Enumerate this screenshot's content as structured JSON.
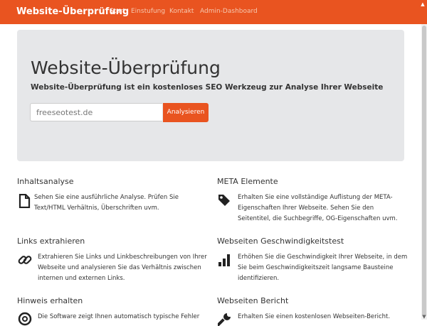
{
  "navbar": {
    "brand": "Website-Überprüfung",
    "items": [
      {
        "label": "Start",
        "active": true
      },
      {
        "label": "Einstufung",
        "active": false
      },
      {
        "label": "Kontakt",
        "active": false
      },
      {
        "label": "Admin-Dashboard",
        "active": false
      }
    ],
    "accent": "#e95420"
  },
  "hero": {
    "title": "Website-Überprüfung",
    "subtitle": "Website-Überprüfung ist ein kostenloses SEO Werkzeug zur Analyse Ihrer Webseite",
    "input_value": "freeseotest.de",
    "button_label": "Analysieren"
  },
  "features": [
    {
      "title": "Inhaltsanalyse",
      "icon": "file-icon",
      "text_lines": [
        "Sehen Sie eine ausführliche Analyse. Prüfen Sie",
        "Text/HTML Verhältnis, Überschriften uvm."
      ]
    },
    {
      "title": "META Elemente",
      "icon": "tag-icon",
      "text_lines": [
        "Erhalten Sie eine vollständige Auflistung der META-",
        "Eigenschaften Ihrer Webseite. Sehen Sie den",
        "Seitentitel, die Suchbegriffe, OG-Eigenschaften uvm."
      ]
    },
    {
      "title": "Links extrahieren",
      "icon": "link-icon",
      "text_lines": [
        "Extrahieren Sie Links und Linkbeschreibungen von Ihrer",
        "Webseite und analysieren Sie das Verhältnis zwischen",
        "internen und externen Links."
      ]
    },
    {
      "title": "Webseiten Geschwindigkeitstest",
      "icon": "bar-chart-icon",
      "text_lines": [
        "Erhöhen Sie die Geschwindigkeit Ihrer Webseite, in dem",
        "Sie beim Geschwindigkeitszeit langsame Bausteine",
        "identifizieren."
      ]
    },
    {
      "title": "Hinweis erhalten",
      "icon": "lifebuoy-icon",
      "text_lines": [
        "Die Software zeigt Ihnen automatisch typische Fehler"
      ]
    },
    {
      "title": "Webseiten Bericht",
      "icon": "wrench-icon",
      "text_lines": [
        "Erhalten Sie einen kostenlosen Webseiten-Bericht."
      ]
    }
  ]
}
